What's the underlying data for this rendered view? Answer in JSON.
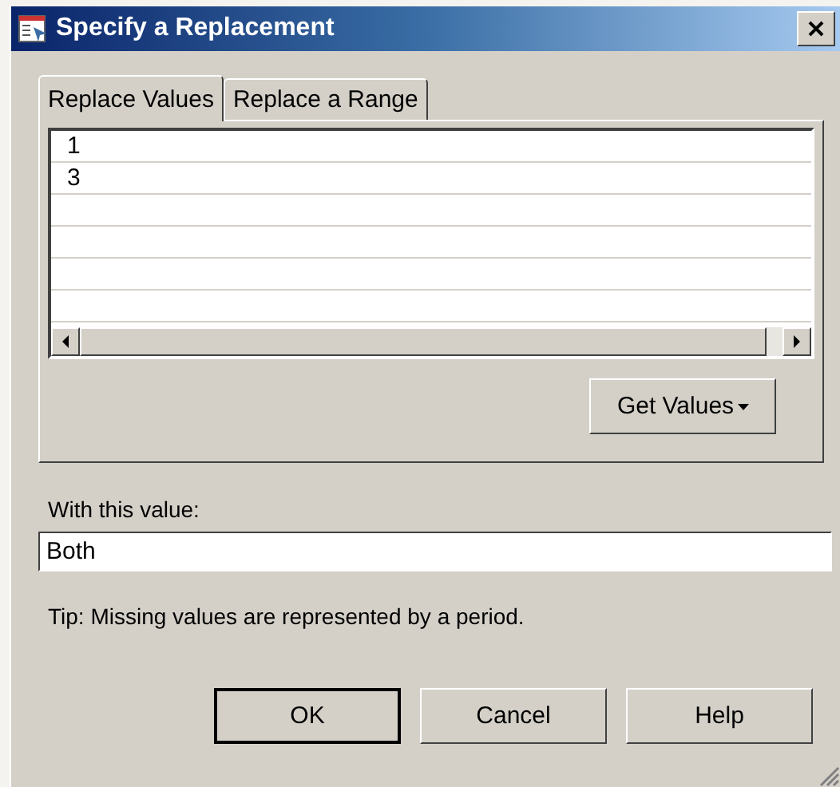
{
  "window": {
    "title": "Specify a Replacement"
  },
  "tabs": [
    {
      "label": "Replace Values",
      "selected": true
    },
    {
      "label": "Replace a Range",
      "selected": false
    }
  ],
  "values_list": {
    "rows": [
      "1",
      "3"
    ]
  },
  "get_values_button": {
    "label": "Get Values"
  },
  "replacement": {
    "label": "With this value:",
    "value": "Both"
  },
  "tip": "Tip: Missing values are represented by a period.",
  "buttons": [
    {
      "label": "OK",
      "default": true
    },
    {
      "label": "Cancel",
      "default": false
    },
    {
      "label": "Help",
      "default": false
    }
  ]
}
